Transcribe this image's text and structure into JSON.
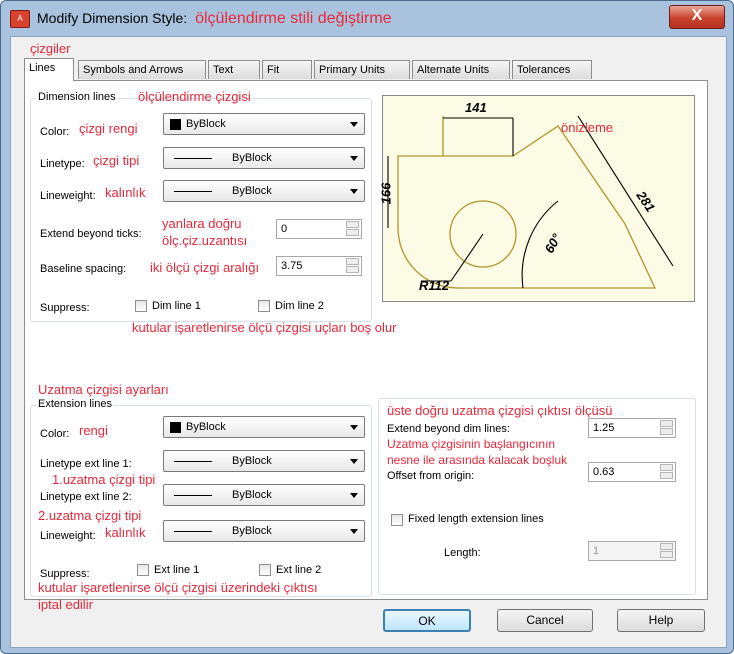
{
  "window": {
    "title": "Modify Dimension Style:",
    "title_note": "ölçülendirme stili değiştirme",
    "close_label": "X"
  },
  "tabs": [
    "Lines",
    "Symbols and Arrows",
    "Text",
    "Fit",
    "Primary Units",
    "Alternate Units",
    "Tolerances"
  ],
  "dimension_lines": {
    "group_title": "Dimension lines",
    "group_note": "ölçülendirme çizgisi",
    "color_label": "Color:",
    "color_note": "çizgi rengi",
    "color_value": "ByBlock",
    "linetype_label": "Linetype:",
    "linetype_note": "çizgi tipi",
    "linetype_value": "ByBlock",
    "lineweight_label": "Lineweight:",
    "lineweight_note": "kalınlık",
    "lineweight_value": "ByBlock",
    "extend_label": "Extend beyond ticks:",
    "extend_note_1": "yanlara doğru",
    "extend_note_2": "ölç.çiz.uzantısı",
    "extend_value": "0",
    "baseline_label": "Baseline spacing:",
    "baseline_note": "iki ölçü çizgi aralığı",
    "baseline_value": "3.75",
    "suppress_label": "Suppress:",
    "dim_line_1": "Dim line 1",
    "dim_line_2": "Dim line 2",
    "suppress_note": "kutular işaretlenirse ölçü çizgisi uçları boş olur"
  },
  "extension_lines": {
    "section_note": "Uzatma çizgisi ayarları",
    "group_title": "Extension lines",
    "color_label": "Color:",
    "color_note": "rengi",
    "color_value": "ByBlock",
    "linetype1_label": "Linetype ext line 1:",
    "linetype1_note": "1.uzatma çizgi tipi",
    "linetype1_value": "ByBlock",
    "linetype2_label": "Linetype ext line 2:",
    "linetype2_note": "2.uzatma çizgi tipi",
    "linetype2_value": "ByBlock",
    "lineweight_label": "Lineweight:",
    "lineweight_note": "kalınlık",
    "lineweight_value": "ByBlock",
    "suppress_label": "Suppress:",
    "ext_line_1": "Ext line 1",
    "ext_line_2": "Ext line 2",
    "suppress_note_1": "kutular işaretlenirse ölçü çizgisi üzerindeki çıktısı",
    "suppress_note_2": "iptal edilir",
    "extend_note": "üste doğru uzatma çizgisi çıktısı ölçüsü",
    "extend_label": "Extend beyond dim lines:",
    "extend_value": "1.25",
    "offset_note_1": "Uzatma çizgisinin başlangıcının",
    "offset_note_2": "nesne ile arasında kalacak boşluk",
    "offset_label": "Offset from origin:",
    "offset_value": "0.63",
    "fixed_label": "Fixed length extension lines",
    "length_label": "Length:",
    "length_value": "1"
  },
  "preview": {
    "note": "önizleme",
    "dim_top": "141",
    "dim_left": "166",
    "dim_right": "281",
    "angle": "60°",
    "radius": "R112"
  },
  "annotations": {
    "lines_tab_note": "çizgiler"
  },
  "buttons": {
    "ok": "OK",
    "cancel": "Cancel",
    "help": "Help"
  },
  "colors": {
    "annotation": "#e8283a",
    "preview_bg": "#fcfbe6",
    "preview_geometry": "#b0962a"
  }
}
